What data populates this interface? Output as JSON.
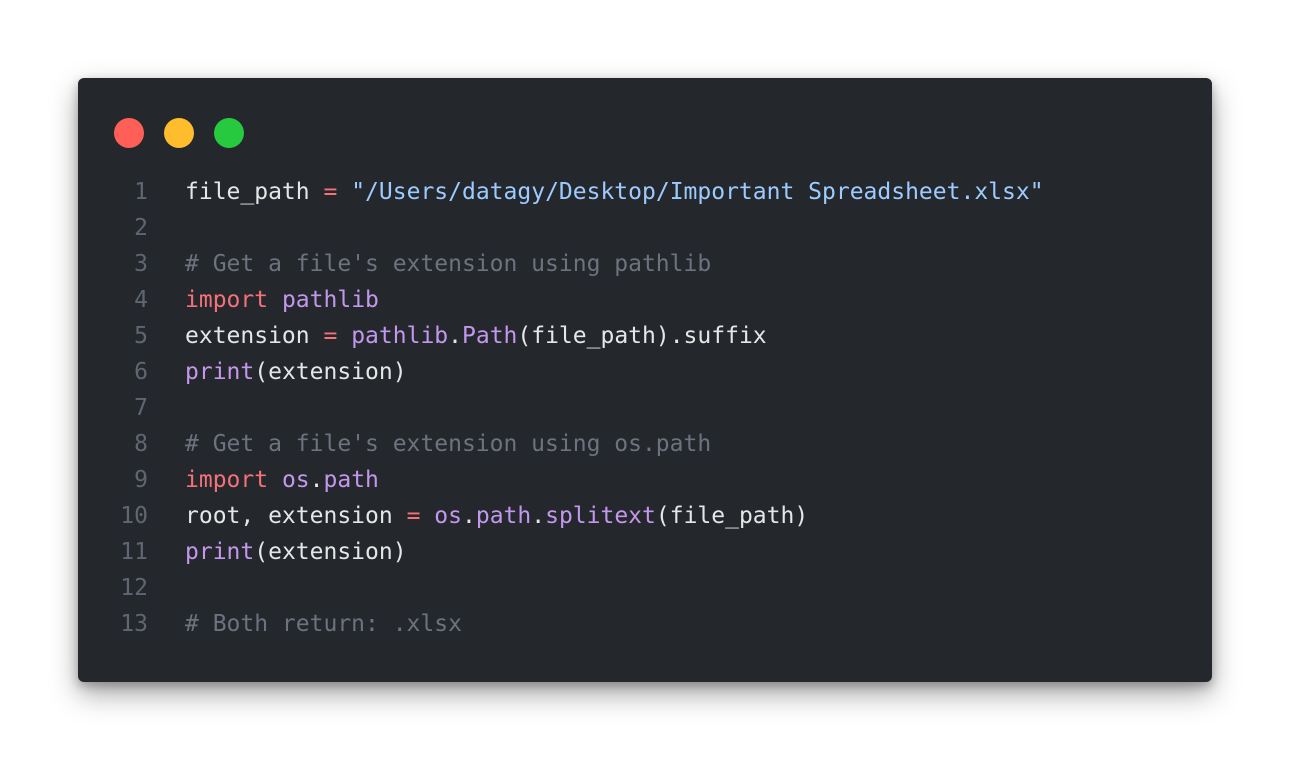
{
  "window": {
    "controls": [
      {
        "name": "close",
        "color": "#ff5f56"
      },
      {
        "name": "minimize",
        "color": "#ffbd2e"
      },
      {
        "name": "maximize",
        "color": "#27c93f"
      }
    ]
  },
  "colors": {
    "background": "#24282d",
    "line_number": "#5f6672",
    "plain": "#e6e6e6",
    "keyword": "#f47178",
    "module": "#c397ec",
    "string": "#9ecbff",
    "comment": "#6c737e"
  },
  "code": {
    "lines": [
      {
        "number": "1",
        "tokens": [
          {
            "t": "file_path ",
            "k": "plain"
          },
          {
            "t": "=",
            "k": "operator"
          },
          {
            "t": " ",
            "k": "plain"
          },
          {
            "t": "\"/Users/datagy/Desktop/Important Spreadsheet.xlsx\"",
            "k": "string"
          }
        ]
      },
      {
        "number": "2",
        "tokens": []
      },
      {
        "number": "3",
        "tokens": [
          {
            "t": "# Get a file's extension using pathlib",
            "k": "comment"
          }
        ]
      },
      {
        "number": "4",
        "tokens": [
          {
            "t": "import",
            "k": "keyword"
          },
          {
            "t": " ",
            "k": "plain"
          },
          {
            "t": "pathlib",
            "k": "module"
          }
        ]
      },
      {
        "number": "5",
        "tokens": [
          {
            "t": "extension ",
            "k": "plain"
          },
          {
            "t": "=",
            "k": "operator"
          },
          {
            "t": " ",
            "k": "plain"
          },
          {
            "t": "pathlib",
            "k": "module"
          },
          {
            "t": ".",
            "k": "plain"
          },
          {
            "t": "Path",
            "k": "func"
          },
          {
            "t": "(file_path).suffix",
            "k": "plain"
          }
        ]
      },
      {
        "number": "6",
        "tokens": [
          {
            "t": "print",
            "k": "func"
          },
          {
            "t": "(extension)",
            "k": "plain"
          }
        ]
      },
      {
        "number": "7",
        "tokens": []
      },
      {
        "number": "8",
        "tokens": [
          {
            "t": "# Get a file's extension using os.path",
            "k": "comment"
          }
        ]
      },
      {
        "number": "9",
        "tokens": [
          {
            "t": "import",
            "k": "keyword"
          },
          {
            "t": " ",
            "k": "plain"
          },
          {
            "t": "os",
            "k": "module"
          },
          {
            "t": ".",
            "k": "plain"
          },
          {
            "t": "path",
            "k": "module"
          }
        ]
      },
      {
        "number": "10",
        "tokens": [
          {
            "t": "root, extension ",
            "k": "plain"
          },
          {
            "t": "=",
            "k": "operator"
          },
          {
            "t": " ",
            "k": "plain"
          },
          {
            "t": "os",
            "k": "module"
          },
          {
            "t": ".",
            "k": "plain"
          },
          {
            "t": "path",
            "k": "module"
          },
          {
            "t": ".",
            "k": "plain"
          },
          {
            "t": "splitext",
            "k": "func"
          },
          {
            "t": "(file_path)",
            "k": "plain"
          }
        ]
      },
      {
        "number": "11",
        "tokens": [
          {
            "t": "print",
            "k": "func"
          },
          {
            "t": "(extension)",
            "k": "plain"
          }
        ]
      },
      {
        "number": "12",
        "tokens": []
      },
      {
        "number": "13",
        "tokens": [
          {
            "t": "# Both return: .xlsx",
            "k": "comment"
          }
        ]
      }
    ]
  }
}
